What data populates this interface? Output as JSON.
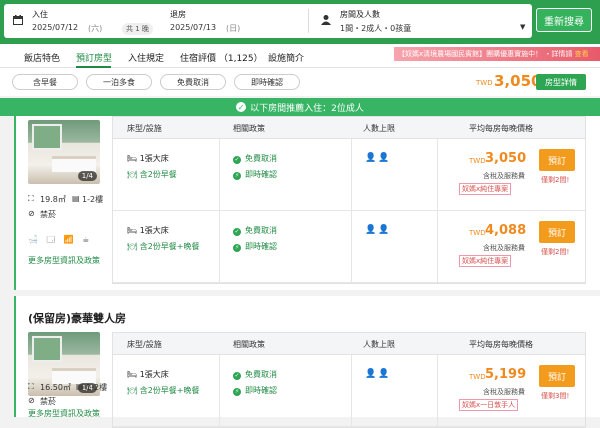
{
  "search": {
    "checkin_label": "入住",
    "checkin_date": "2025/07/12",
    "checkin_weekday": "(六)",
    "nights": "共 1 晚",
    "checkout_label": "退房",
    "checkout_date": "2025/07/13",
    "checkout_weekday": "(日)",
    "guests_label": "房間及人數",
    "guests_value": "1間・2成人・0孩童",
    "search_button": "重新搜尋"
  },
  "tabs": [
    "飯店特色",
    "預訂房型",
    "入住規定",
    "住宿評價 （1,125）",
    "設施簡介"
  ],
  "active_tab": "預訂房型",
  "promo": {
    "text": "【奴媽x清境農場國民賓館】團購優惠實施中！ ・詳情請",
    "link": "查看"
  },
  "filters": [
    "含早餐",
    "一泊多食",
    "免費取消",
    "即時確認"
  ],
  "top_price": {
    "currency": "TWD",
    "value": "3,050",
    "detail_button": "房型詳情"
  },
  "banner": "以下房間推薦入住：2位成人",
  "table_headers": {
    "room": "床型/設施",
    "policy": "相關政策",
    "capacity": "人數上限",
    "price": "平均每房每晚價格"
  },
  "rooms": [
    {
      "title": "",
      "photo_count": "1/4",
      "size": "19.8㎡",
      "floor": "1-2樓",
      "smoking": "禁菸",
      "amenities": "🛁 🗔 📶 ☕",
      "more_link": "更多房型資訊及政策",
      "rates": [
        {
          "bed": "1張大床",
          "meal": "含2份早餐",
          "policy1": "免費取消",
          "policy2": "即時確認",
          "currency": "TWD",
          "price": "3,050",
          "tax": "含稅及服務費",
          "tag": "奴媽x純住專案",
          "book": "預訂",
          "left": "僅剩2間!"
        },
        {
          "bed": "1張大床",
          "meal": "含2份早餐+晚餐",
          "policy1": "免費取消",
          "policy2": "即時確認",
          "currency": "TWD",
          "price": "4,088",
          "tax": "含稅及服務費",
          "tag": "奴媽x純住專案",
          "book": "預訂",
          "left": "僅剩2間!"
        }
      ]
    },
    {
      "title": "(保留房)豪華雙人房",
      "photo_count": "1/4",
      "size": "16.50㎡",
      "floor": "1-2樓",
      "smoking": "禁菸",
      "more_link": "更多房型資訊及政策",
      "rates": [
        {
          "bed": "1張大床",
          "meal": "含2份早餐+晚餐",
          "policy1": "免費取消",
          "policy2": "即時確認",
          "currency": "TWD",
          "price": "5,199",
          "tax": "含稅及服務費",
          "tag": "奴媽x一日敦手人",
          "book": "預訂",
          "left": "僅剩3間!"
        }
      ]
    }
  ]
}
